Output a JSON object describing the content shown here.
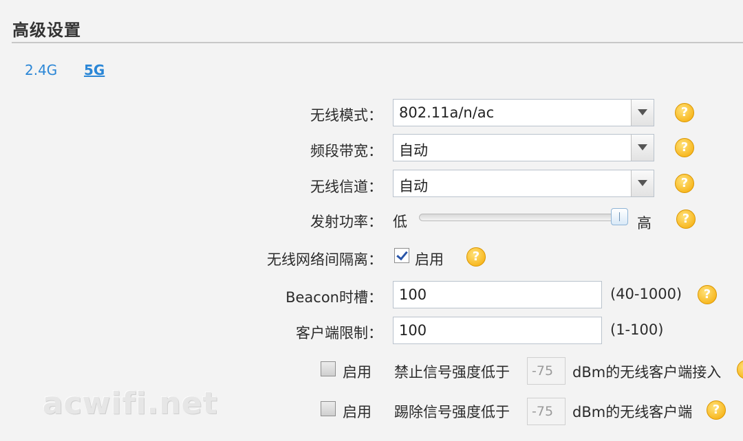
{
  "page": {
    "title": "高级设置"
  },
  "tabs": [
    {
      "label": "2.4G",
      "active": false
    },
    {
      "label": "5G",
      "active": true
    }
  ],
  "help_glyph": "?",
  "wireless_mode": {
    "label": "无线模式：",
    "value": "802.11a/n/ac"
  },
  "bandwidth": {
    "label": "频段带宽：",
    "value": "自动"
  },
  "channel": {
    "label": "无线信道：",
    "value": "自动"
  },
  "tx_power": {
    "label": "发射功率：",
    "low": "低",
    "high": "高",
    "level_fraction": 1.0
  },
  "isolation": {
    "label": "无线网络间隔离：",
    "checked": true,
    "text": "启用"
  },
  "beacon": {
    "label": "Beacon时槽：",
    "value": "100",
    "range": "(40-1000)"
  },
  "client_limit": {
    "label": "客户端限制：",
    "value": "100",
    "range": "(1-100)"
  },
  "weak_block": {
    "checked": false,
    "enable_text": "启用",
    "prefix": "禁止信号强度低于",
    "value": "-75",
    "suffix": "dBm的无线客户端接入"
  },
  "weak_kick": {
    "checked": false,
    "enable_text": "启用",
    "prefix": "踢除信号强度低于",
    "value": "-75",
    "suffix": "dBm的无线客户端"
  },
  "watermark": "acwifi.net"
}
